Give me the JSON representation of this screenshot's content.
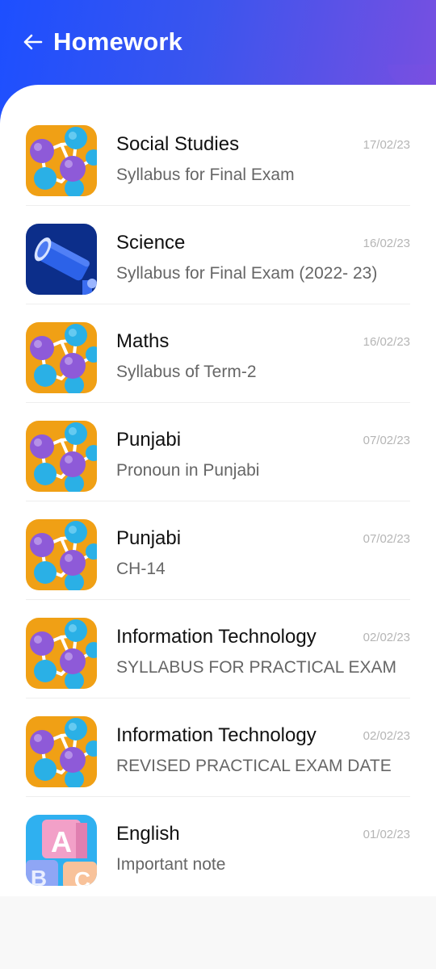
{
  "header": {
    "title": "Homework",
    "back_icon": "arrow-left-icon",
    "gradient_colors": [
      "#1d4fff",
      "#7a4fe0"
    ]
  },
  "homework": [
    {
      "subject": "Social Studies",
      "description": "Syllabus for Final Exam",
      "date": "17/02/23",
      "icon": "molecule-icon"
    },
    {
      "subject": "Science",
      "description": "Syllabus for Final Exam (2022- 23)",
      "date": "16/02/23",
      "icon": "telescope-icon"
    },
    {
      "subject": "Maths",
      "description": "Syllabus of Term-2",
      "date": "16/02/23",
      "icon": "molecule-icon"
    },
    {
      "subject": "Punjabi",
      "description": "Pronoun in Punjabi",
      "date": "07/02/23",
      "icon": "molecule-icon"
    },
    {
      "subject": "Punjabi",
      "description": "CH-14",
      "date": "07/02/23",
      "icon": "molecule-icon"
    },
    {
      "subject": "Information Technology",
      "description": "SYLLABUS FOR PRACTICAL EXAM",
      "date": "02/02/23",
      "icon": "molecule-icon"
    },
    {
      "subject": "Information Technology",
      "description": "REVISED PRACTICAL EXAM DATE",
      "date": "02/02/23",
      "icon": "molecule-icon"
    },
    {
      "subject": "English",
      "description": "Important note",
      "date": "01/02/23",
      "icon": "abc-blocks-icon"
    }
  ]
}
